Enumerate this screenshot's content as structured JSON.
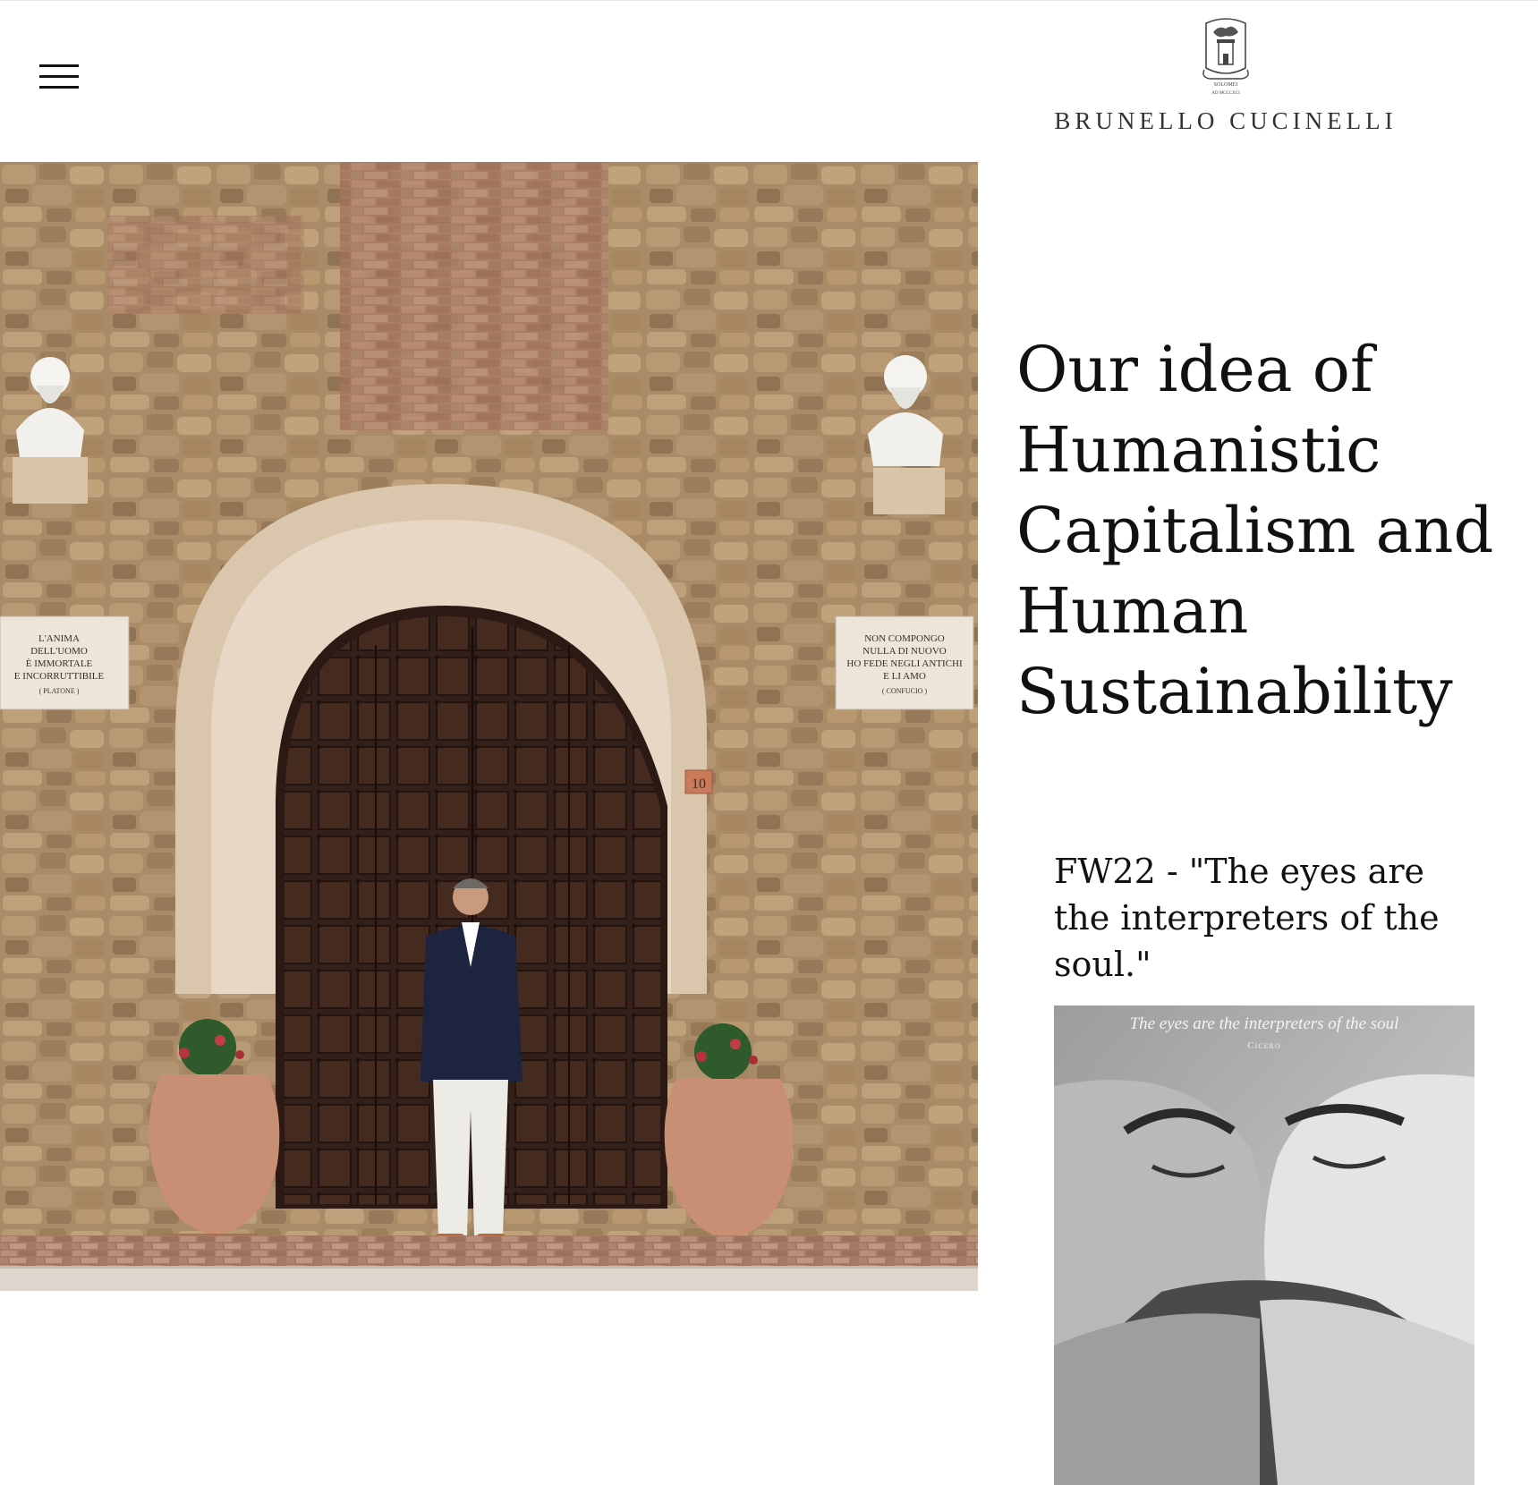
{
  "header": {
    "brand_name": "BRUNELLO CUCINELLI",
    "crest_motto": "SOLOMEI",
    "crest_year": "AD MCCCXCI",
    "menu_icon": "hamburger-menu-icon"
  },
  "hero": {
    "plaque_left": {
      "lines": [
        "L'ANIMA",
        "DELL'UOMO",
        "È IMMORTALE",
        "E INCORRUTTIBILE"
      ],
      "author": "( PLATONE )"
    },
    "plaque_right": {
      "lines": [
        "NON COMPONGO",
        "NULLA DI NUOVO",
        "HO FEDE NEGLI ANTICHI",
        "E LI AMO"
      ],
      "author": "( CONFUCIO )"
    },
    "door_number": "10"
  },
  "headline": {
    "lines": [
      "Our idea of",
      "Humanistic",
      "Capitalism and",
      "Human",
      "Sustainability"
    ]
  },
  "story": {
    "title_lines": [
      "FW22 - \"The eyes are",
      "the interpreters of the",
      "soul.\""
    ],
    "image_caption": "The eyes are the interpreters of the soul",
    "image_author": "Cicero"
  },
  "colors": {
    "background": "#ffffff",
    "text": "#111111",
    "stone": "#a88a66",
    "door": "#3a2218"
  }
}
